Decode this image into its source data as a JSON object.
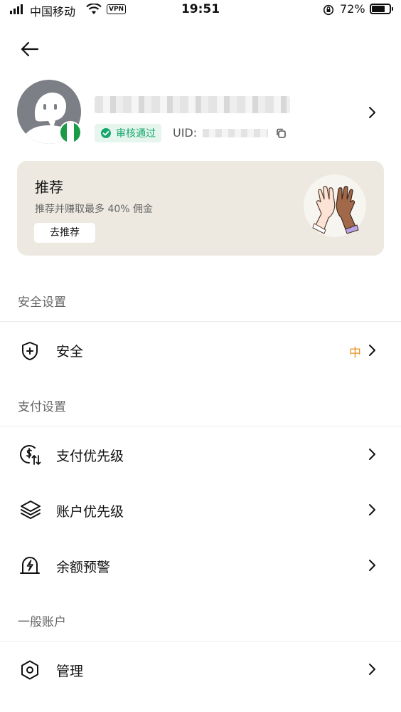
{
  "status_bar": {
    "carrier": "中国移动",
    "vpn": "VPN",
    "time": "19:51",
    "battery": "72%"
  },
  "nav": {
    "back_icon": "arrow-left-icon"
  },
  "profile": {
    "verified_label": "审核通过",
    "uid_label": "UID:",
    "colors": {
      "verified_green": "#16a76b",
      "flag_green": "#1a9b47"
    }
  },
  "promo": {
    "title": "推荐",
    "subtitle": "推荐并赚取最多 40% 佣金",
    "button": "去推荐"
  },
  "sections": {
    "security": "安全设置",
    "payment": "支付设置",
    "general": "一般账户"
  },
  "rows": {
    "security": {
      "label": "安全",
      "level": "中",
      "icon": "shield-plus-icon"
    },
    "payment_priority": {
      "label": "支付优先级",
      "icon": "dollar-sort-icon"
    },
    "account_priority": {
      "label": "账户优先级",
      "icon": "layers-icon"
    },
    "balance_alert": {
      "label": "余额预警",
      "icon": "bell-bolt-icon"
    },
    "manage": {
      "label": "管理",
      "icon": "hexagon-icon"
    }
  },
  "accent_colors": {
    "level_medium": "#e8942a",
    "promo_bg": "#ede9e0"
  }
}
